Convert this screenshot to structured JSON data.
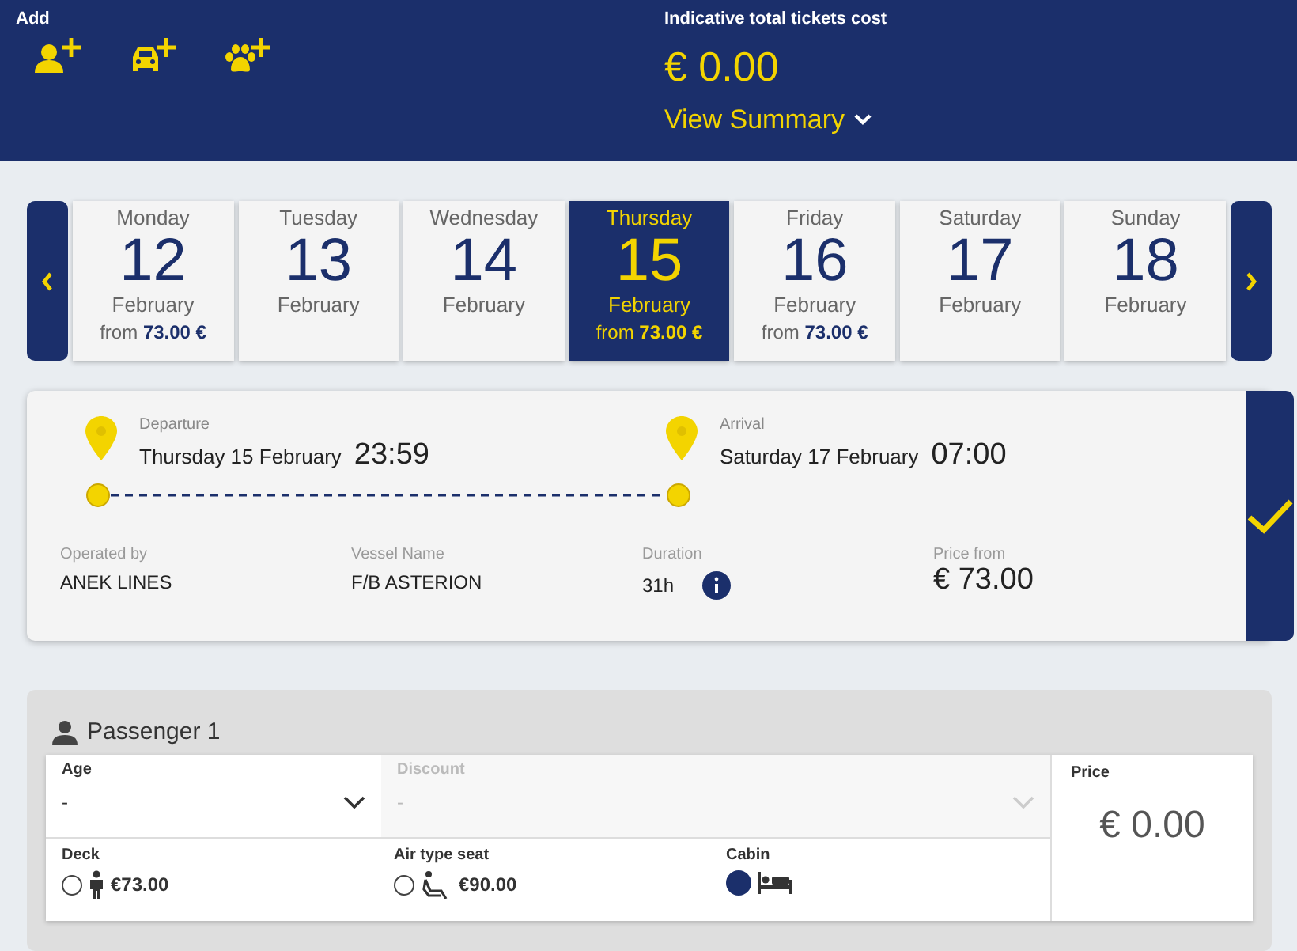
{
  "header": {
    "add_label": "Add",
    "add_buttons": [
      {
        "kind": "passenger"
      },
      {
        "kind": "vehicle"
      },
      {
        "kind": "pet"
      }
    ],
    "cost_label": "Indicative total tickets cost",
    "cost": "€ 0.00",
    "summary_link": "View Summary"
  },
  "dates": [
    {
      "weekday": "Monday",
      "day": "12",
      "month": "February",
      "price_prefix": "from",
      "price": "73.00 €",
      "selected": false
    },
    {
      "weekday": "Tuesday",
      "day": "13",
      "month": "February",
      "selected": false
    },
    {
      "weekday": "Wednesday",
      "day": "14",
      "month": "February",
      "selected": false
    },
    {
      "weekday": "Thursday",
      "day": "15",
      "month": "February",
      "price_prefix": "from",
      "price": "73.00 €",
      "selected": true
    },
    {
      "weekday": "Friday",
      "day": "16",
      "month": "February",
      "price_prefix": "from",
      "price": "73.00 €",
      "selected": false
    },
    {
      "weekday": "Saturday",
      "day": "17",
      "month": "February",
      "selected": false
    },
    {
      "weekday": "Sunday",
      "day": "18",
      "month": "February",
      "selected": false
    }
  ],
  "trip": {
    "departure": {
      "label": "Departure",
      "date": "Thursday 15 February",
      "time": "23:59"
    },
    "arrival": {
      "label": "Arrival",
      "date": "Saturday 17 February",
      "time": "07:00"
    },
    "details": [
      {
        "label": "Operated by",
        "value": "ANEK LINES"
      },
      {
        "label": "Vessel Name",
        "value": "F/B ASTERION"
      },
      {
        "label": "Duration",
        "value": "31h",
        "info": true
      },
      {
        "label": "Price from",
        "value": "€ 73.00",
        "kind": "price"
      }
    ],
    "selected": true
  },
  "passenger": {
    "title": "Passenger 1",
    "fields": [
      {
        "label": "Age",
        "value": "-",
        "disabled": false
      },
      {
        "label": "Discount",
        "value": "-",
        "disabled": true
      }
    ],
    "accommodations": [
      {
        "label": "Deck",
        "kind": "deck",
        "price": "€73.00",
        "selected": false
      },
      {
        "label": "Air type seat",
        "kind": "seat",
        "price": "€90.00",
        "selected": false
      },
      {
        "label": "Cabin",
        "kind": "cabin",
        "selected": true
      }
    ],
    "price_label": "Price",
    "price": "€ 0.00"
  }
}
